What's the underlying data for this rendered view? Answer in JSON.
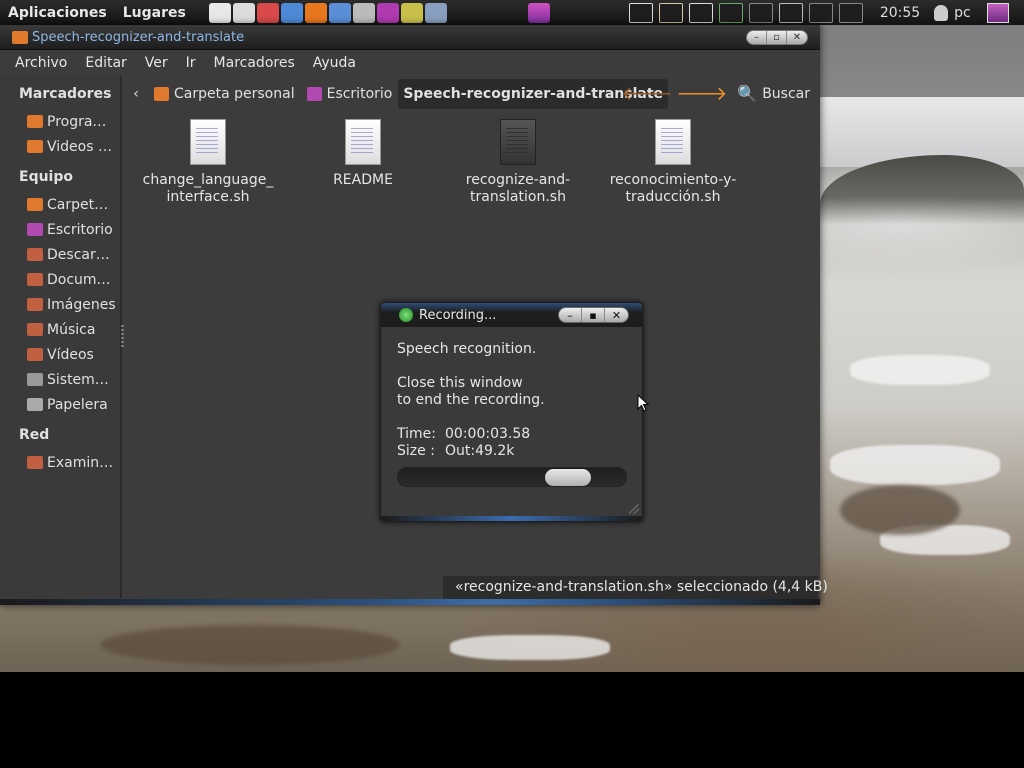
{
  "top_panel": {
    "menus": [
      "Aplicaciones",
      "Lugares"
    ],
    "launchers": [
      {
        "icon": "text-editor-icon",
        "color": "#e8e8e8"
      },
      {
        "icon": "calculator-icon",
        "color": "#dcdcdc"
      },
      {
        "icon": "paint-icon",
        "color": "#d84a4a"
      },
      {
        "icon": "database-icon",
        "color": "#4d8ad8"
      },
      {
        "icon": "firefox-icon",
        "color": "#e8781e"
      },
      {
        "icon": "chromium-icon",
        "color": "#5a8fd8"
      },
      {
        "icon": "terminal-screenshot-icon",
        "color": "#bbbbbb"
      },
      {
        "icon": "screen-capture-icon",
        "color": "#b03ab0"
      },
      {
        "icon": "record-icon",
        "color": "#c9c04a"
      },
      {
        "icon": "network-tools-icon",
        "color": "#8aa0c0"
      }
    ],
    "center_icon": "recording-app-icon",
    "tray": [
      {
        "icon": "terminal-icon",
        "color": "#dddddd"
      },
      {
        "icon": "mail-icon",
        "color": "#d8c9a0"
      },
      {
        "icon": "notes-icon",
        "color": "#dddddd"
      },
      {
        "icon": "monitor-icon",
        "color": "#66aa66"
      },
      {
        "icon": "screen-icon",
        "color": "#8a8a8a"
      },
      {
        "icon": "email-icon",
        "color": "#bbbbbb"
      },
      {
        "icon": "network-icon",
        "color": "#888888"
      },
      {
        "icon": "volume-muted-icon",
        "color": "#888888"
      }
    ],
    "clock": "20:55",
    "user": "pc"
  },
  "window": {
    "title": "Speech-recognizer-and-translate",
    "menubar": [
      "Archivo",
      "Editar",
      "Ver",
      "Ir",
      "Marcadores",
      "Ayuda"
    ],
    "sidebar": {
      "sections": [
        {
          "title": "Marcadores",
          "items": [
            {
              "label": "Progra…",
              "color": "#e0782d"
            },
            {
              "label": "Videos …",
              "color": "#e0782d"
            }
          ]
        },
        {
          "title": "Equipo",
          "items": [
            {
              "label": "Carpet…",
              "color": "#e0782d"
            },
            {
              "label": "Escritorio",
              "color": "#b04ab0"
            },
            {
              "label": "Descar…",
              "color": "#c06040"
            },
            {
              "label": "Docum…",
              "color": "#c06040"
            },
            {
              "label": "Imágenes",
              "color": "#c06040"
            },
            {
              "label": "Música",
              "color": "#c06040"
            },
            {
              "label": "Vídeos",
              "color": "#c06040"
            },
            {
              "label": "Sistem…",
              "color": "#999999"
            },
            {
              "label": "Papelera",
              "color": "#aaaaaa"
            }
          ]
        },
        {
          "title": "Red",
          "items": [
            {
              "label": "Examin…",
              "color": "#c06040"
            }
          ]
        }
      ]
    },
    "pathbar": {
      "crumbs": [
        {
          "label": "Carpeta personal",
          "icon": "home-folder-icon",
          "color": "#e0782d"
        },
        {
          "label": "Escritorio",
          "icon": "desktop-folder-icon",
          "color": "#b04ab0"
        },
        {
          "label": "Speech-recognizer-and-translate",
          "icon": "",
          "color": ""
        }
      ],
      "search_label": "Buscar"
    },
    "files": [
      {
        "name_line1": "change_language_",
        "name_line2": "interface.sh",
        "dark": false
      },
      {
        "name_line1": "README",
        "name_line2": "",
        "dark": false
      },
      {
        "name_line1": "recognize-and-",
        "name_line2": "translation.sh",
        "dark": true
      },
      {
        "name_line1": "reconocimiento-y-",
        "name_line2": "traducción.sh",
        "dark": false
      }
    ],
    "status": "«recognize-and-translation.sh» seleccionado (4,4 kB)"
  },
  "dialog": {
    "title": "Recording...",
    "line1": "Speech recognition.",
    "line2": "Close this window",
    "line3": "to end the recording.",
    "time_label": "Time:",
    "time_value": "00:00:03.58",
    "size_label": "Size :",
    "size_value": "Out:49.2k",
    "progress": 0.8
  }
}
